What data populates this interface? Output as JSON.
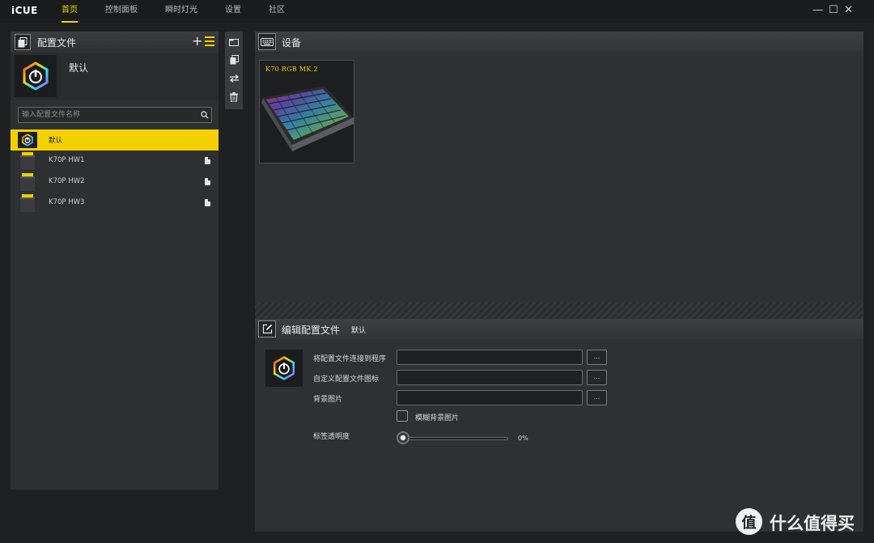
{
  "app": {
    "logo": "iCUE"
  },
  "nav": {
    "items": [
      "首页",
      "控制面板",
      "瞬时灯光",
      "设置",
      "社区"
    ],
    "active_index": 0
  },
  "window_controls": {
    "minimize": "—",
    "maximize": "☐",
    "close": "✕"
  },
  "profiles_panel": {
    "title": "配置文件",
    "add_label": "+",
    "current_profile": "默认",
    "search_placeholder": "输入配置文件名称",
    "search_value": "",
    "items": [
      {
        "name": "默认",
        "selected": true,
        "type": "software"
      },
      {
        "name": "K70P HW1",
        "selected": false,
        "type": "hardware"
      },
      {
        "name": "K70P HW2",
        "selected": false,
        "type": "hardware"
      },
      {
        "name": "K70P HW3",
        "selected": false,
        "type": "hardware"
      }
    ]
  },
  "toolbar": {
    "icons": [
      "new-window-icon",
      "copy-icon",
      "swap-icon",
      "trash-icon"
    ]
  },
  "devices": {
    "title": "设备",
    "device_name": "K70 RGB MK.2"
  },
  "edit_profile": {
    "title": "编辑配置文件",
    "profile_name": "默认",
    "link_program_label": "将配置文件连接到程序",
    "link_program_value": "",
    "custom_icon_label": "自定义配置文件图标",
    "custom_icon_value": "",
    "background_label": "背景图片",
    "background_value": "",
    "browse_label": "...",
    "blur_label": "模糊背景图片",
    "blur_checked": false,
    "opacity_label": "标签透明度",
    "opacity_value": "0%",
    "opacity_fraction": 0
  },
  "watermark": {
    "symbol": "值",
    "text": "什么值得买"
  },
  "colors": {
    "accent": "#f0d000",
    "background": "#1f2022",
    "panel": "#2e2f31"
  }
}
